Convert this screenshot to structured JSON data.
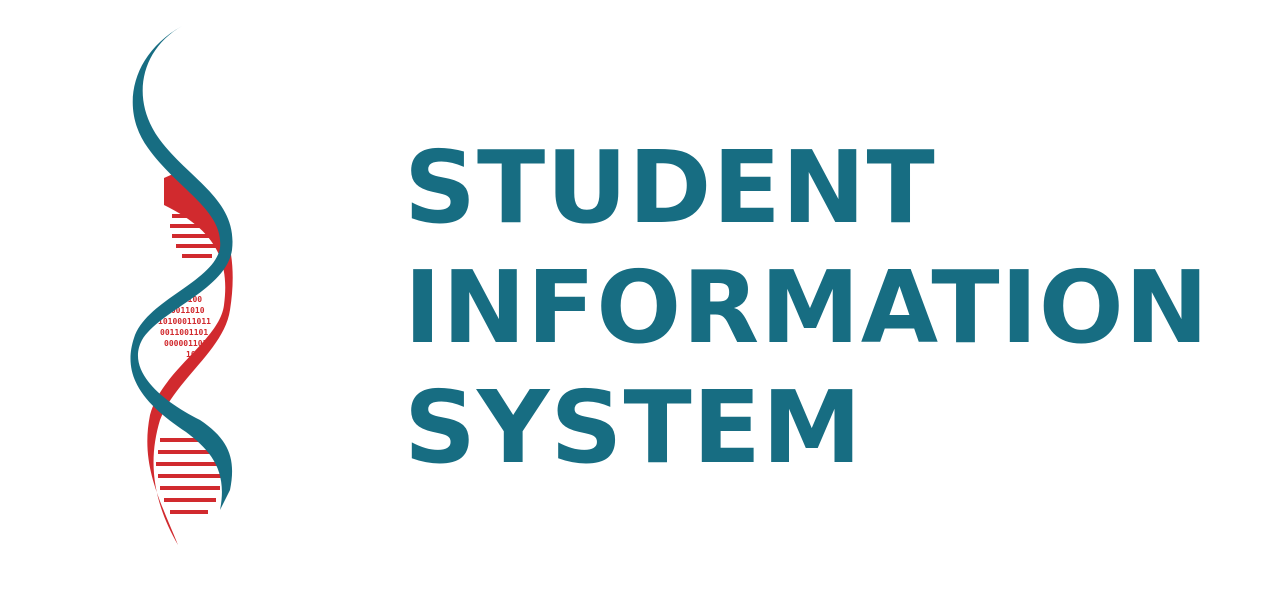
{
  "title": {
    "line1": "STUDENT",
    "line2": "INFORMATION",
    "line3": "SYSTEM"
  },
  "logo": {
    "icon": "dna-helix-icon",
    "binary_text": [
      "01100",
      "10011010",
      "10100011011",
      "0011001101",
      "0000011010",
      "1010"
    ]
  },
  "colors": {
    "primary_teal": "#176d82",
    "accent_red": "#d12a2e"
  }
}
